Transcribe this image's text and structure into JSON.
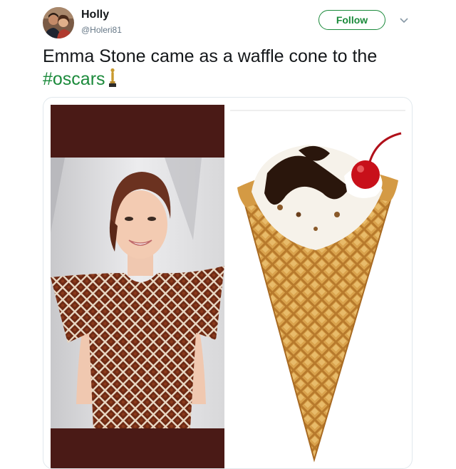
{
  "user": {
    "display_name": "Holly",
    "handle": "@Holeri81"
  },
  "follow_button": {
    "label": "Follow"
  },
  "tweet": {
    "text": "Emma Stone came as a waffle cone to the",
    "hashtag": "#oscars"
  },
  "icons": {
    "menu": "chevron-down-icon",
    "trophy": "oscar-statuette-icon"
  },
  "colors": {
    "accent": "#1b8a3b",
    "text": "#14171a",
    "muted": "#657786",
    "dress": "#6e2a14",
    "waffle": "#d9a24c",
    "cherry": "#c8101a"
  }
}
